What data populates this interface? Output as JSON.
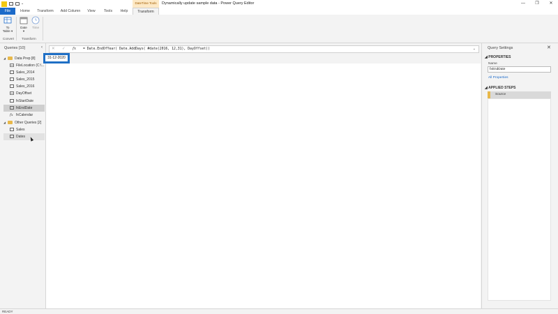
{
  "titlebar": {
    "context_tab_label": "DateTime Tools",
    "window_title": "Dynamically update sample data - Power Query Editor",
    "controls": {
      "minimize": "—",
      "maximize": "❐",
      "close": "✕"
    }
  },
  "ribbon_tabs": [
    "File",
    "Home",
    "Transform",
    "Add Column",
    "View",
    "Tools",
    "Help",
    "Transform"
  ],
  "ribbon": {
    "to_table_line1": "To",
    "to_table_line2": "Table ▾",
    "date_label": "Date",
    "date_arrow": "▾",
    "time_label": "Time",
    "group_convert": "Convert",
    "group_transform": "Transform"
  },
  "queries": {
    "title": "Queries [10]",
    "collapse": "‹",
    "folders": [
      {
        "name": "Data Prep [8]",
        "items": [
          {
            "label": "FileLocation (C:\\...",
            "icon": "parameter-icon"
          },
          {
            "label": "Sales_2014",
            "icon": "table-icon"
          },
          {
            "label": "Sales_2015",
            "icon": "table-icon"
          },
          {
            "label": "Sales_2016",
            "icon": "table-icon"
          },
          {
            "label": "DayOffset",
            "icon": "number-icon"
          },
          {
            "label": "fxStartDate",
            "icon": "table-icon"
          },
          {
            "label": "fxEndDate",
            "icon": "table-icon",
            "selected": true
          },
          {
            "label": "fxCalendar",
            "icon": "function-icon"
          }
        ]
      },
      {
        "name": "Other Queries [2]",
        "items": [
          {
            "label": "Sales",
            "icon": "table-icon"
          },
          {
            "label": "Dates",
            "icon": "table-icon",
            "hover": true
          }
        ]
      }
    ]
  },
  "formula_bar": {
    "cancel": "✕",
    "commit": "✓",
    "fx": "fx",
    "formula": "= Date.EndOfYear( Date.AddDays( #date(2016, 12,31), DayOffset))",
    "expand": "⌄"
  },
  "result": {
    "value": "31-12-2020"
  },
  "settings": {
    "title": "Query Settings",
    "close": "✕",
    "properties_heading": "PROPERTIES",
    "name_label": "Name",
    "name_value": "fxEndDate",
    "all_properties_link": "All Properties",
    "applied_steps_heading": "APPLIED STEPS",
    "steps": [
      "Source"
    ]
  },
  "status": {
    "text": "READY"
  },
  "colors": {
    "accent": "#1b6ac9",
    "highlight_border": "#1f6fc5",
    "context_tab": "#fde9c6",
    "folder": "#e8b84a"
  }
}
